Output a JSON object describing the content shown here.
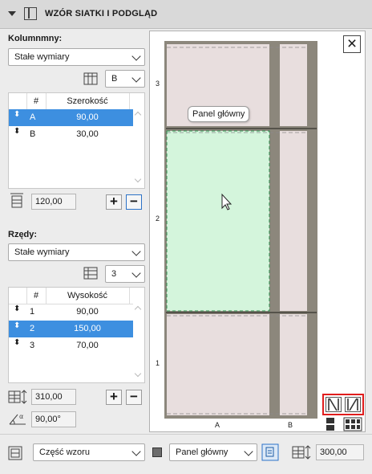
{
  "header": {
    "title": "WZÓR SIATKI I PODGLĄD",
    "collapse_icon": "triangle-down-icon",
    "panel_icon": "grid-pattern-icon"
  },
  "columns": {
    "label": "Kolumnmny:",
    "mode": "Stałe wymiary",
    "current": "B",
    "headers": {
      "num": "#",
      "value": "Szerokość"
    },
    "rows": [
      {
        "id": "A",
        "value": "90,00",
        "selected": true
      },
      {
        "id": "B",
        "value": "30,00",
        "selected": false
      }
    ],
    "total": "120,00",
    "add": "+",
    "remove": "−"
  },
  "rows_section": {
    "label": "Rzędy:",
    "mode": "Stałe wymiary",
    "current": "3",
    "headers": {
      "num": "#",
      "value": "Wysokość"
    },
    "rows": [
      {
        "id": "1",
        "value": "90,00",
        "selected": false
      },
      {
        "id": "2",
        "value": "150,00",
        "selected": true
      },
      {
        "id": "3",
        "value": "70,00",
        "selected": false
      }
    ],
    "total": "310,00",
    "angle": "90,00°",
    "add": "+",
    "remove": "−"
  },
  "preview": {
    "tooltip": "Panel główny",
    "row_labels": [
      "3",
      "2",
      "1"
    ],
    "col_labels": [
      "A",
      "B"
    ],
    "close": "×",
    "colors": {
      "panel": "#e8dede",
      "selected_panel": "#d4f5dc",
      "frame": "#8c877c",
      "accent_red": "#e01d1d"
    }
  },
  "bottom": {
    "pattern_part": "Część wzoru",
    "panel": "Panel główny",
    "value": "300,00"
  }
}
